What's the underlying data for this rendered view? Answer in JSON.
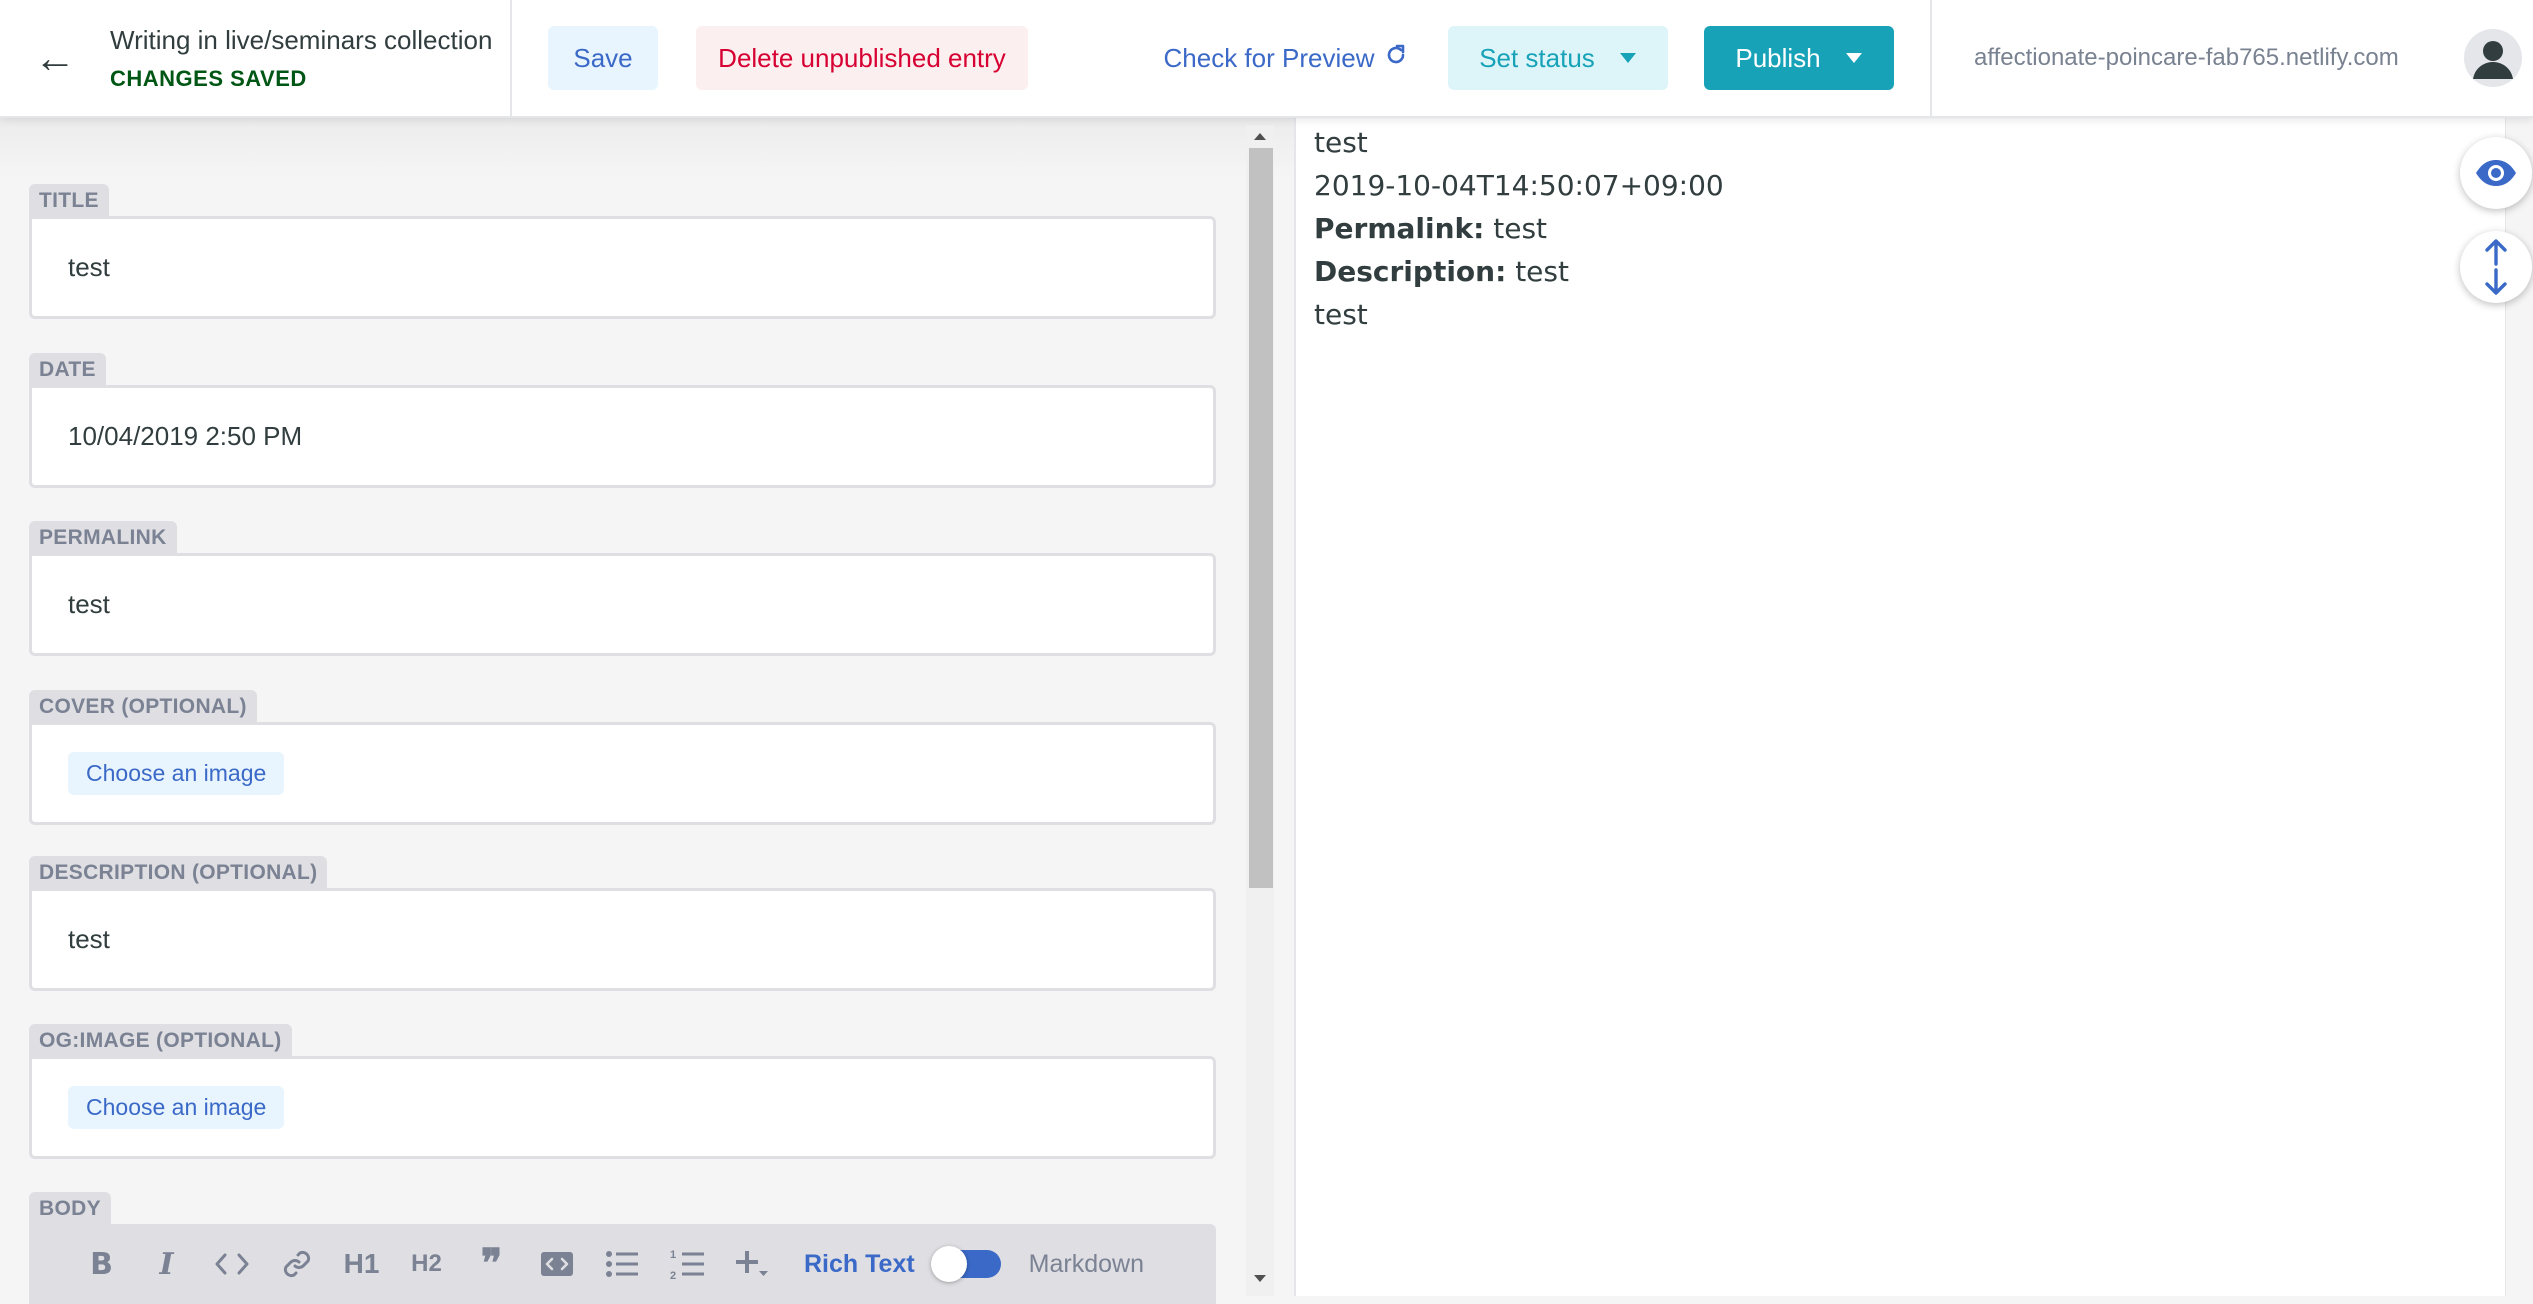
{
  "header": {
    "back_label": "←",
    "collection_title": "Writing in live/seminars collection",
    "save_status": "CHANGES SAVED",
    "save_label": "Save",
    "delete_label": "Delete unpublished entry",
    "preview_label": "Check for Preview",
    "status_label": "Set status",
    "publish_label": "Publish",
    "site_url": "affectionate-poincare-fab765.netlify.com"
  },
  "fields": {
    "title": {
      "label": "TITLE",
      "value": "test"
    },
    "date": {
      "label": "DATE",
      "value": "10/04/2019 2:50 PM"
    },
    "permalink": {
      "label": "PERMALINK",
      "value": "test"
    },
    "cover": {
      "label": "COVER (OPTIONAL)",
      "button": "Choose an image"
    },
    "description": {
      "label": "DESCRIPTION (OPTIONAL)",
      "value": "test"
    },
    "og_image": {
      "label": "OG:IMAGE (OPTIONAL)",
      "button": "Choose an image"
    },
    "body": {
      "label": "BODY",
      "toolbar": {
        "bold": "B",
        "italic": "I",
        "code": "<>",
        "h1": "H1",
        "h2": "H2",
        "quote": "❞",
        "rich_text": "Rich Text",
        "markdown": "Markdown"
      }
    }
  },
  "preview": {
    "title": "test",
    "date": "2019-10-04T14:50:07+09:00",
    "permalink_label": "Permalink:",
    "permalink_value": "test",
    "description_label": "Description:",
    "description_value": "test",
    "body": "test"
  },
  "colors": {
    "accent": "#3a69c7",
    "publish": "#17a2b8",
    "danger": "#d60032",
    "success": "#005614"
  }
}
